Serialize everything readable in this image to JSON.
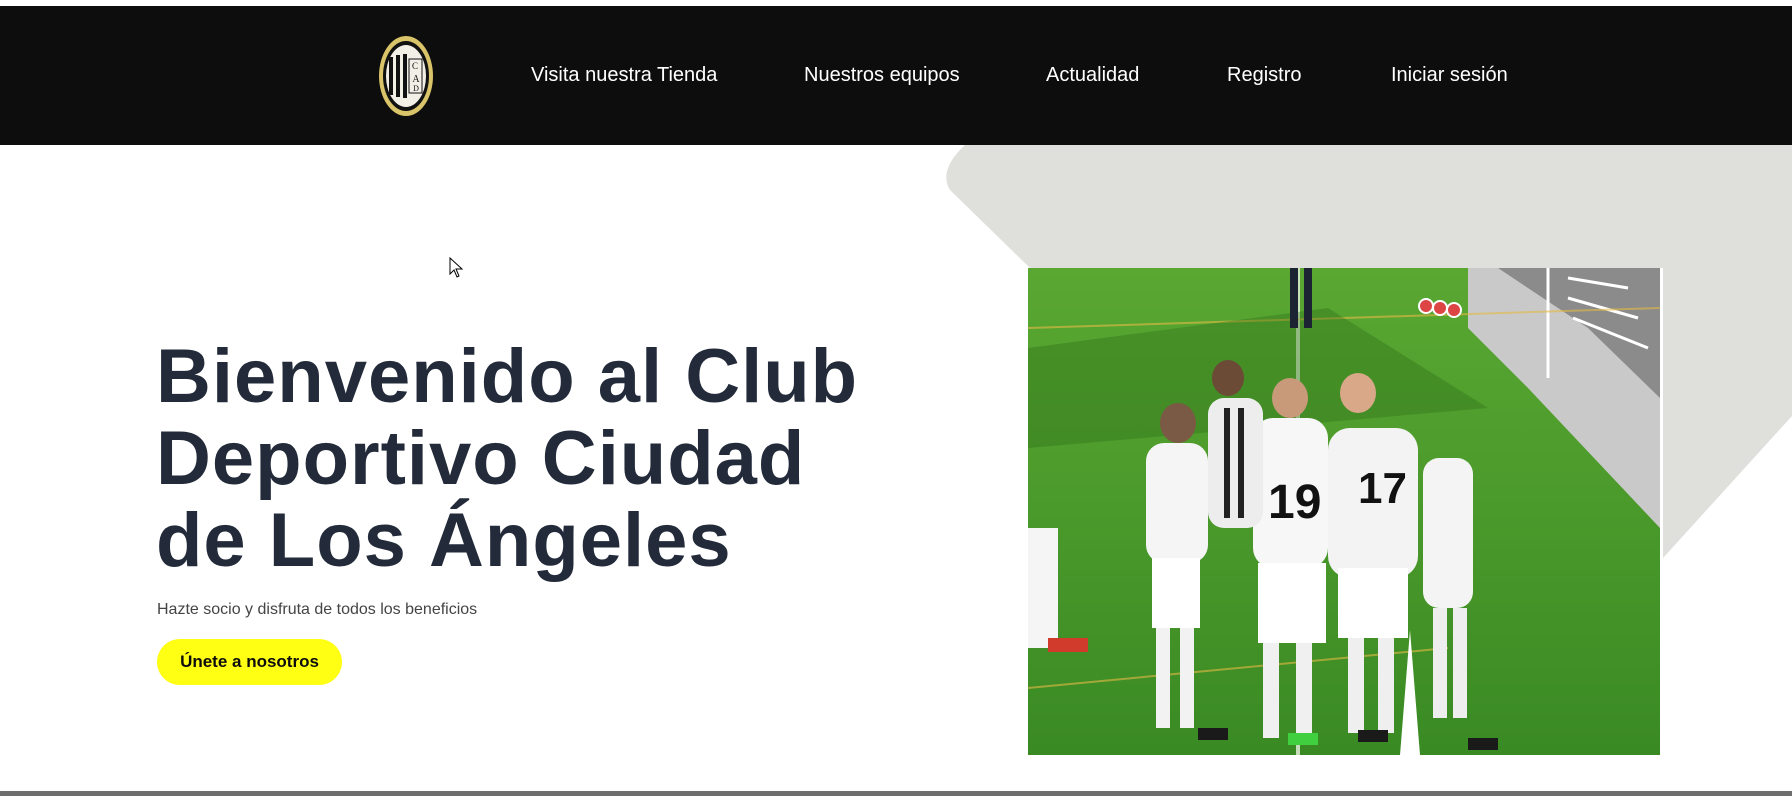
{
  "header": {
    "logo_icon": "club-crest-icon",
    "nav": [
      {
        "label": "Visita nuestra Tienda"
      },
      {
        "label": "Nuestros equipos"
      },
      {
        "label": "Actualidad"
      },
      {
        "label": "Registro"
      },
      {
        "label": "Iniciar sesión"
      }
    ]
  },
  "hero": {
    "title_line1": "Bienvenido al Club",
    "title_line2": "Deportivo Ciudad",
    "title_line3": "de Los Ángeles",
    "subtitle": "Hazte socio y disfruta de todos los beneficios",
    "cta_label": "Únete a nosotros",
    "photo_icon": "team-celebration-photo"
  },
  "colors": {
    "header_bg": "#0d0d0d",
    "title": "#232b3a",
    "cta_bg": "#ffff14",
    "shape_bg": "#dedede",
    "turf": "#3f9a2a"
  }
}
